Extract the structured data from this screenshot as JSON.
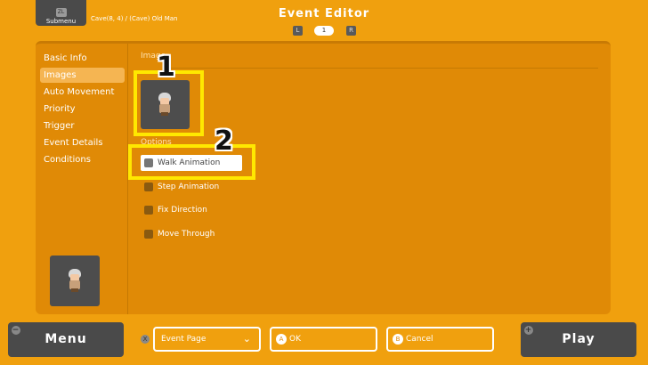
{
  "header": {
    "submenu_key": "ZL",
    "submenu_label": "Submenu",
    "location": "Cave(8, 4) / (Cave) Old Man",
    "title": "Event Editor",
    "pager": {
      "left_key": "L",
      "page": "1",
      "right_key": "R"
    }
  },
  "sidebar": {
    "items": [
      {
        "label": "Basic Info"
      },
      {
        "label": "Images"
      },
      {
        "label": "Auto Movement"
      },
      {
        "label": "Priority"
      },
      {
        "label": "Trigger"
      },
      {
        "label": "Event Details"
      },
      {
        "label": "Conditions"
      }
    ],
    "active_index": 1
  },
  "main": {
    "images_label": "Image",
    "options_label": "Options",
    "options": [
      {
        "label": "Walk Animation",
        "selected": true
      },
      {
        "label": "Step Animation",
        "selected": false
      },
      {
        "label": "Fix Direction",
        "selected": false
      },
      {
        "label": "Move Through",
        "selected": false
      }
    ],
    "callouts": [
      "1",
      "2"
    ]
  },
  "footer": {
    "menu_label": "Menu",
    "menu_corner": "−",
    "play_label": "Play",
    "play_corner": "+",
    "x_key": "X",
    "event_page_label": "Event Page",
    "ok_key": "A",
    "ok_label": "OK",
    "cancel_key": "B",
    "cancel_label": "Cancel"
  },
  "colors": {
    "background": "#f0a00e",
    "panel": "#e08a06",
    "highlight": "#ffe800",
    "button_dark": "#4a4a4a"
  }
}
